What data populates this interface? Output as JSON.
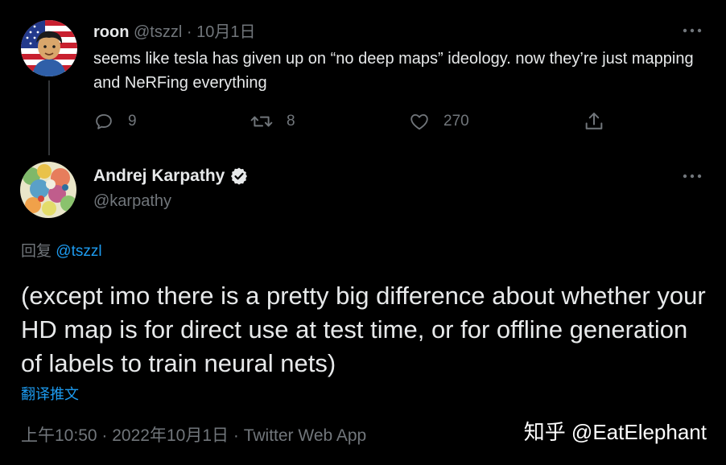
{
  "parent_tweet": {
    "author_name": "roon",
    "author_handle": "@tszzl",
    "separator": "·",
    "date": "10月1日",
    "text": "seems like tesla has given up on “no deep maps” ideology. now they’re just mapping and NeRFing everything",
    "avatar_icon": "cartoon-avatar-american-flag",
    "actions": {
      "reply_count": "9",
      "retweet_count": "8",
      "like_count": "270"
    }
  },
  "main_tweet": {
    "author_name": "Andrej Karpathy",
    "author_handle": "@karpathy",
    "verified": true,
    "avatar_icon": "abstract-colorful-avatar",
    "reply_prefix": "回复",
    "reply_to": "@tszzl",
    "text": "(except imo there is a pretty big difference about whether your HD map is for direct use at test time, or for offline generation of labels to train neural nets)",
    "translate_label": "翻译推文",
    "time": "上午10:50",
    "separator": "·",
    "date": "2022年10月1日",
    "source": "Twitter Web App"
  },
  "watermark": "知乎 @EatElephant",
  "colors": {
    "background": "#000000",
    "primary_text": "#e7e9ea",
    "secondary_text": "#71767b",
    "link": "#1d9bf0",
    "thread_line": "#333639"
  }
}
